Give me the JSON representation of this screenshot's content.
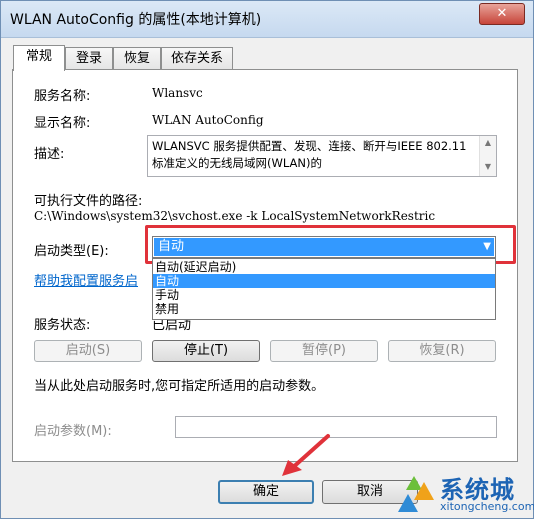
{
  "window": {
    "title": "WLAN AutoConfig 的属性(本地计算机)",
    "close": "✕"
  },
  "tabs": [
    {
      "label": "常规",
      "active": true
    },
    {
      "label": "登录"
    },
    {
      "label": "恢复"
    },
    {
      "label": "依存关系"
    }
  ],
  "general": {
    "service_name_label": "服务名称:",
    "service_name": "Wlansvc",
    "display_name_label": "显示名称:",
    "display_name": "WLAN AutoConfig",
    "description_label": "描述:",
    "description": "WLANSVC 服务提供配置、发现、连接、断开与IEEE 802.11 标准定义的无线局域网(WLAN)的",
    "exe_path_label": "可执行文件的路径:",
    "exe_path": "C:\\Windows\\system32\\svchost.exe -k LocalSystemNetworkRestric",
    "startup_type_label": "启动类型(E):",
    "startup_type_value": "自动",
    "startup_options": [
      "自动(延迟启动)",
      "自动",
      "手动",
      "禁用"
    ],
    "startup_highlight_index": 1,
    "help_link": "帮助我配置服务启",
    "service_status_label": "服务状态:",
    "service_status": "已启动",
    "buttons": {
      "start": "启动(S)",
      "stop": "停止(T)",
      "pause": "暂停(P)",
      "resume": "恢复(R)"
    },
    "start_params_hint": "当从此处启动服务时,您可指定所适用的启动参数。",
    "start_params_label": "启动参数(M):",
    "start_params_value": ""
  },
  "footer": {
    "ok": "确定",
    "cancel": "取消"
  },
  "watermark": {
    "brand": "系统城",
    "url": "xitongcheng.com"
  },
  "colors": {
    "highlight": "#3399ff",
    "callout": "#e0323a",
    "link": "#0066cc"
  }
}
